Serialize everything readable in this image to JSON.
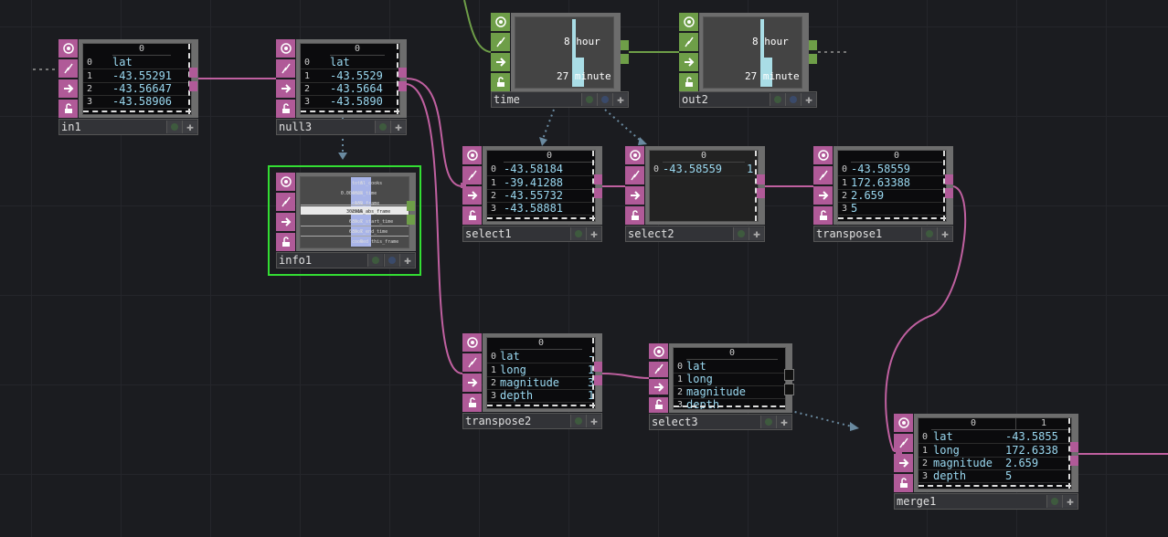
{
  "nodes": {
    "in1": {
      "name": "in1",
      "col": "0",
      "rows": [
        {
          "i": "0",
          "v": "lat"
        },
        {
          "i": "1",
          "v": "-43.55291"
        },
        {
          "i": "2",
          "v": "-43.56647"
        },
        {
          "i": "3",
          "v": "-43.58906"
        }
      ]
    },
    "null3": {
      "name": "null3",
      "col": "0",
      "rows": [
        {
          "i": "0",
          "v": "lat"
        },
        {
          "i": "1",
          "v": "-43.5529"
        },
        {
          "i": "2",
          "v": "-43.5664"
        },
        {
          "i": "3",
          "v": "-43.5890"
        }
      ]
    },
    "time": {
      "name": "time",
      "hour": "8 hour",
      "minute": "27 minute"
    },
    "out2": {
      "name": "out2",
      "hour": "8 hour",
      "minute": "27 minute"
    },
    "info1": {
      "name": "info1",
      "lines": [
        {
          "v": "6",
          "k": "total_cooks"
        },
        {
          "v": "0.004028",
          "k": "cook_time"
        },
        {
          "v": "139",
          "k": "cook_frame"
        },
        {
          "v": "302916",
          "k": "cook_abs_frame"
        },
        {
          "v": "639.7",
          "k": "cook_start_time"
        },
        {
          "v": "639.7",
          "k": "cook_end_time"
        },
        {
          "v": "0",
          "k": "cooked_this_frame"
        }
      ]
    },
    "select1": {
      "name": "select1",
      "col": "0",
      "rows": [
        {
          "i": "0",
          "v": "-43.58184"
        },
        {
          "i": "1",
          "v": "-39.41288"
        },
        {
          "i": "2",
          "v": "-43.55732"
        },
        {
          "i": "3",
          "v": "-43.58881"
        }
      ]
    },
    "select2": {
      "name": "select2",
      "col": "0",
      "rows": [
        {
          "i": "0",
          "v": "-43.58559",
          "x": "1"
        }
      ]
    },
    "transpose1": {
      "name": "transpose1",
      "col": "0",
      "rows": [
        {
          "i": "0",
          "v": "-43.58559"
        },
        {
          "i": "1",
          "v": "172.63388"
        },
        {
          "i": "2",
          "v": "2.659"
        },
        {
          "i": "3",
          "v": "5"
        }
      ]
    },
    "transpose2": {
      "name": "transpose2",
      "col": "0",
      "rows": [
        {
          "i": "0",
          "v": "lat",
          "x": "-"
        },
        {
          "i": "1",
          "v": "long",
          "x": "1"
        },
        {
          "i": "2",
          "v": "magnitude",
          "x": "3"
        },
        {
          "i": "3",
          "v": "depth",
          "x": "1"
        }
      ]
    },
    "select3": {
      "name": "select3",
      "col": "0",
      "rows": [
        {
          "i": "0",
          "v": "lat"
        },
        {
          "i": "1",
          "v": "long"
        },
        {
          "i": "2",
          "v": "magnitude"
        },
        {
          "i": "3",
          "v": "depth"
        }
      ]
    },
    "merge1": {
      "name": "merge1",
      "col0": "0",
      "col1": "1",
      "rows": [
        {
          "i": "0",
          "v": "lat",
          "w": "-43.5855"
        },
        {
          "i": "1",
          "v": "long",
          "w": "172.6338"
        },
        {
          "i": "2",
          "v": "magnitude",
          "w": "2.659"
        },
        {
          "i": "3",
          "v": "depth",
          "w": "5"
        }
      ]
    }
  },
  "colors": {
    "dat": "#b05a98",
    "chop": "#6e9e48",
    "selection": "#33dd33",
    "background": "#1b1c20"
  },
  "icons": {
    "strip": [
      "viewer-active-icon",
      "bypass-icon",
      "export-arrow-icon",
      "lock-icon"
    ],
    "footer": [
      "display-flag-icon",
      "render-flag-icon",
      "add-icon"
    ]
  }
}
